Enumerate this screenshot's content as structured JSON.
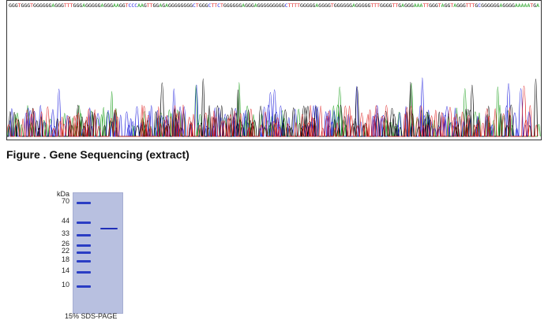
{
  "sequence_text": "GGGTGGGTGGGGGGAGGGTTTGGGAGGGGGAGGGAAGGTCCCAAGTTGGAGAGGGGGGGGCTGGGCTTCTGGGGGGAGGGAGGGGGGGGGCTTTTGGGGGAGGGGTGGGGGGAGGGGGTTTGGGGTTGAGGGAAATTGGGTAGGTAGGGTTTGCGGGGGGAGGGGAAAAATGA",
  "trace_colors": {
    "A": "#1a9e1a",
    "C": "#2222dd",
    "G": "#000000",
    "T": "#dd2222"
  },
  "figure_caption": "Figure . Gene Sequencing (extract)",
  "gel": {
    "unit_label": "kDa",
    "markers": [
      {
        "label": "70",
        "kda": 70
      },
      {
        "label": "44",
        "kda": 44
      },
      {
        "label": "33",
        "kda": 33
      },
      {
        "label": "26",
        "kda": 26
      },
      {
        "label": "22",
        "kda": 22
      },
      {
        "label": "18",
        "kda": 18
      },
      {
        "label": "14",
        "kda": 14
      },
      {
        "label": "10",
        "kda": 10
      }
    ],
    "sample_band_kda": 38,
    "caption": "15% SDS-PAGE"
  }
}
